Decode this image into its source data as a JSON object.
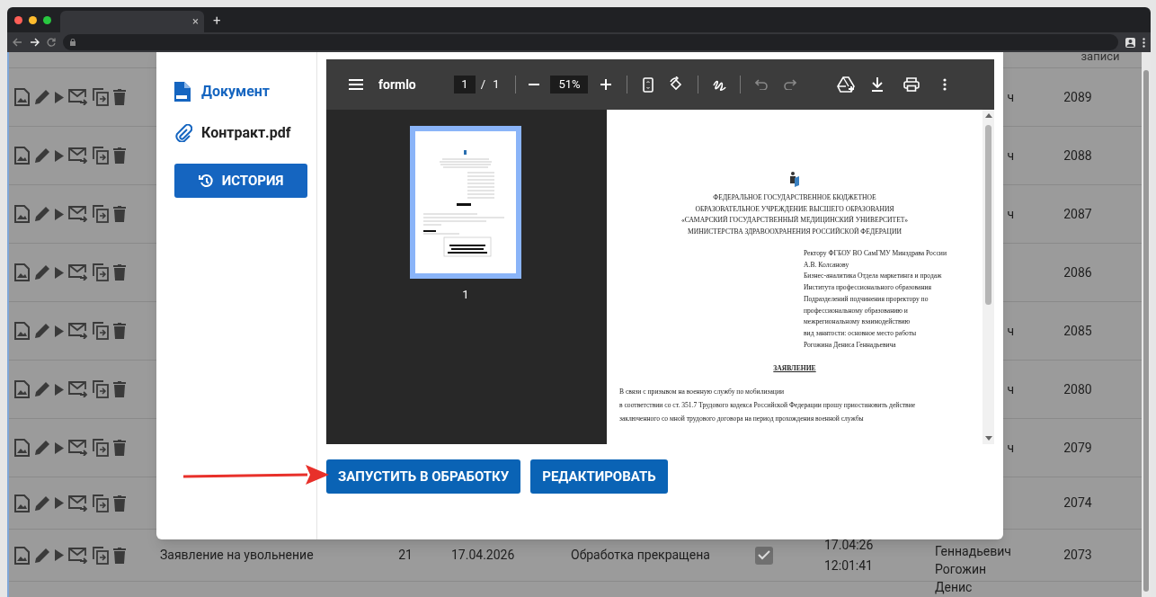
{
  "browser": {
    "tab_close": "×",
    "new_tab": "+"
  },
  "table": {
    "header_fragment": "записи",
    "rows": [
      {
        "name_fragment": "ч",
        "record": "2089"
      },
      {
        "name_fragment": "ч",
        "record": "2088"
      },
      {
        "name_fragment": "ч",
        "record": "2087"
      },
      {
        "record": "2086"
      },
      {
        "name_fragment": "ч",
        "record": "2085"
      },
      {
        "name_fragment": "ч",
        "record": "2080"
      },
      {
        "name_fragment": "ч",
        "record": "2079"
      },
      {
        "record": "2074"
      },
      {
        "title": "Заявление на увольнение",
        "number": "21",
        "date": "17.04.2026",
        "status": "Обработка прекращена",
        "done": true,
        "time": [
          "17.04:26",
          "12:01:41"
        ],
        "author": [
          "Геннадьевич",
          "Рогожин",
          "Денис"
        ],
        "record": "2073"
      }
    ]
  },
  "dialog": {
    "sidebar": {
      "document_link": "Документ",
      "file_name": "Контракт.pdf",
      "history_button": "ИСТОРИЯ"
    },
    "viewer": {
      "title": "formlo",
      "page": "1",
      "page_separator": "/",
      "page_count": "1",
      "zoom": "51%",
      "thumbnail_label": "1",
      "document": {
        "heading": [
          "ФЕДЕРАЛЬНОЕ ГОСУДАРСТВЕННОЕ БЮДЖЕТНОЕ",
          "ОБРАЗОВАТЕЛЬНОЕ УЧРЕЖДЕНИЕ ВЫСШЕГО ОБРАЗОВАНИЯ",
          "«САМАРСКИЙ ГОСУДАРСТВЕННЫЙ МЕДИЦИНСКИЙ УНИВЕРСИТЕТ»",
          "МИНИСТЕРСТВА ЗДРАВООХРАНЕНИЯ РОССИЙСКОЙ ФЕДЕРАЦИИ"
        ],
        "addressee": [
          "Ректору ФГБОУ ВО СамГМУ Минздрава России",
          "А.В. Колсанову",
          "Бизнес-аналитика Отдела маркетинга и продаж",
          "Института профессионального образования",
          "Подразделений подчинения проректору по",
          "профессиональному образованию и",
          "межрегиональному взаимодействию",
          "вид занятости: основное место работы",
          "Рогожина Дениса Геннадьевича"
        ],
        "doc_title": "ЗАЯВЛЕНИЕ",
        "body": [
          "В связи с призывом на военную службу по мобилизации",
          "в соответствии со ст. 351.7 Трудового кодекса Российской Федерации прошу приостановить действие",
          "заключенного со мной трудового договора на период прохождения военной службы"
        ]
      }
    },
    "buttons": [
      {
        "label": "ЗАПУСТИТЬ В ОБРАБОТКУ"
      },
      {
        "label": "РЕДАКТИРОВАТЬ"
      }
    ]
  }
}
